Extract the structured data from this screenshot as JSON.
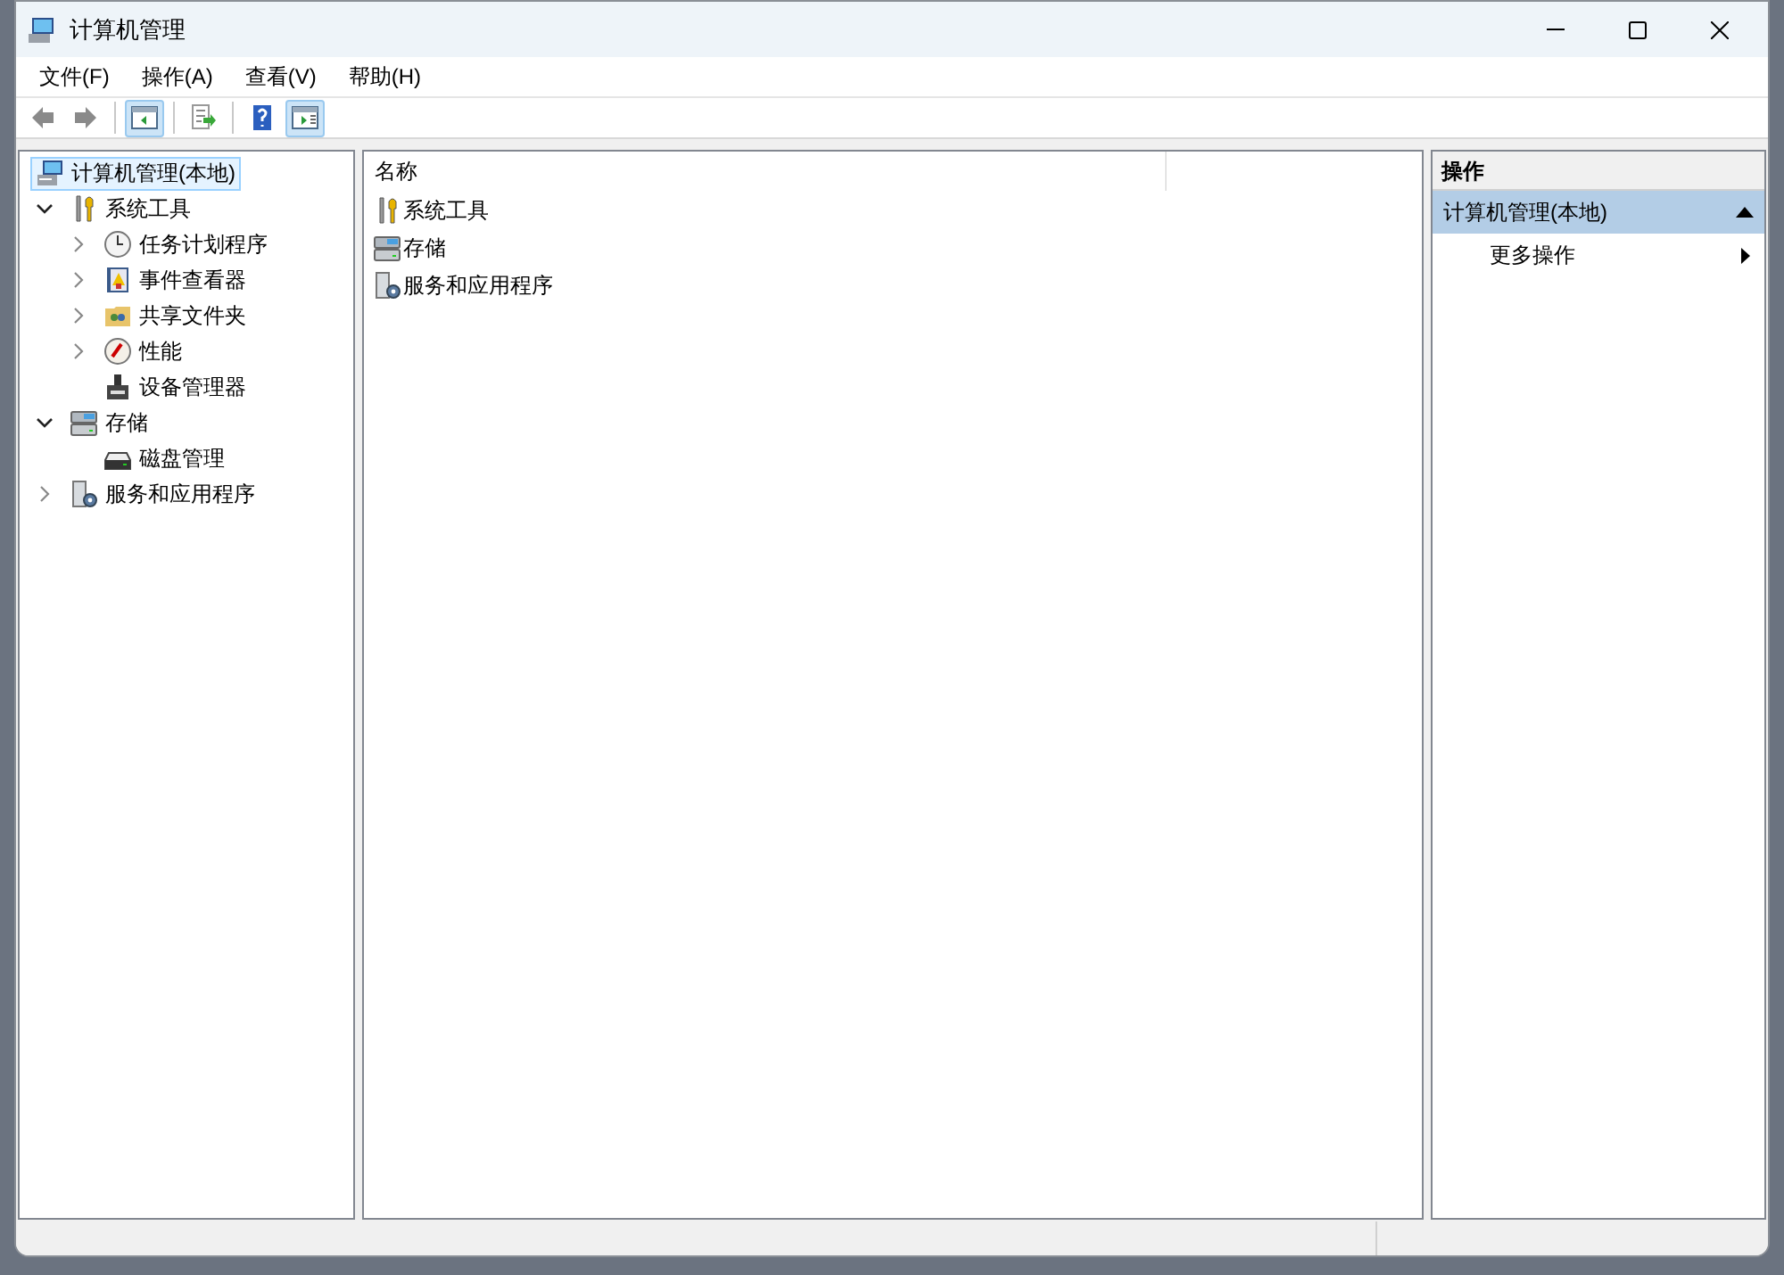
{
  "window": {
    "title": "计算机管理"
  },
  "menu": [
    "文件(F)",
    "操作(A)",
    "查看(V)",
    "帮助(H)"
  ],
  "toolbar": [
    {
      "kind": "back",
      "pressed": false
    },
    {
      "kind": "forward",
      "pressed": false
    },
    {
      "kind": "sep"
    },
    {
      "kind": "tree",
      "pressed": true
    },
    {
      "kind": "sep"
    },
    {
      "kind": "export",
      "pressed": false
    },
    {
      "kind": "sep"
    },
    {
      "kind": "help",
      "pressed": false
    },
    {
      "kind": "pane",
      "pressed": true
    }
  ],
  "tree": [
    {
      "label": "计算机管理(本地)",
      "kind": "computer",
      "selected": true,
      "children": [
        {
          "label": "系统工具",
          "kind": "tools",
          "selected": false,
          "expanded": true,
          "children": [
            {
              "label": "任务计划程序",
              "kind": "clock",
              "selected": false,
              "expanded": false
            },
            {
              "label": "事件查看器",
              "kind": "log",
              "selected": false,
              "expanded": false
            },
            {
              "label": "共享文件夹",
              "kind": "share",
              "selected": false,
              "expanded": false
            },
            {
              "label": "性能",
              "kind": "gauge",
              "selected": false,
              "expanded": false
            },
            {
              "label": "设备管理器",
              "kind": "device",
              "selected": false
            }
          ]
        },
        {
          "label": "存储",
          "kind": "storage",
          "selected": false,
          "expanded": true,
          "children": [
            {
              "label": "磁盘管理",
              "kind": "disk",
              "selected": false
            }
          ]
        },
        {
          "label": "服务和应用程序",
          "kind": "services",
          "selected": false,
          "expanded": false
        }
      ]
    }
  ],
  "list": {
    "columns": [
      "名称"
    ],
    "rows": [
      {
        "label": "系统工具",
        "kind": "tools"
      },
      {
        "label": "存储",
        "kind": "storage"
      },
      {
        "label": "服务和应用程序",
        "kind": "services"
      }
    ]
  },
  "actions": {
    "header": "操作",
    "groups": [
      {
        "title": "计算机管理(本地)",
        "expanded": true,
        "items": [
          "更多操作"
        ]
      }
    ]
  }
}
